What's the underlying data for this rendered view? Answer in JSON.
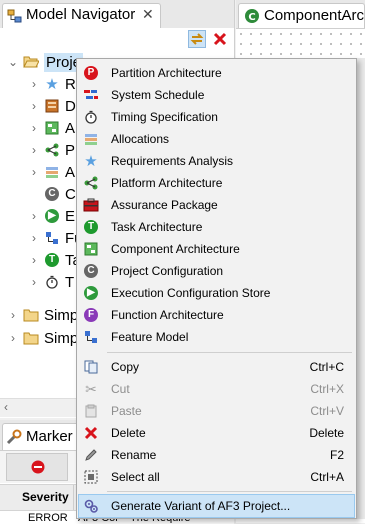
{
  "colors": {
    "selection": "#cce4f7",
    "selection_border": "#99c9ef"
  },
  "navigator": {
    "title": "Model Navigator",
    "tree": [
      {
        "label": "Proje",
        "icon": "open-folder-icon",
        "expanded": true
      },
      {
        "label": "R",
        "icon": "star-icon"
      },
      {
        "label": "D",
        "icon": "data-dictionary-icon"
      },
      {
        "label": "A",
        "icon": "component-icon"
      },
      {
        "label": "P",
        "icon": "platform-icon"
      },
      {
        "label": "A",
        "icon": "allocation-icon"
      },
      {
        "label": "C",
        "icon": "configuration-icon"
      },
      {
        "label": "E",
        "icon": "execution-icon"
      },
      {
        "label": "Fu",
        "icon": "feature-icon"
      },
      {
        "label": "Ta",
        "icon": "task-icon"
      },
      {
        "label": "T",
        "icon": "stopwatch-icon"
      },
      {
        "label": "Simp",
        "icon": "folder-icon"
      },
      {
        "label": "Simp",
        "icon": "folder-icon"
      }
    ]
  },
  "markers": {
    "title": "Marker T",
    "column_severity": "Severity",
    "row_severity": "ERROR",
    "row_element": "AF3 Cor",
    "row_message": "The Require"
  },
  "editor": {
    "title": "ComponentArch"
  },
  "context_menu": {
    "group1": [
      {
        "label": "Partition Architecture",
        "icon": "partition-icon"
      },
      {
        "label": "System Schedule",
        "icon": "schedule-icon"
      },
      {
        "label": "Timing Specification",
        "icon": "stopwatch-icon"
      },
      {
        "label": "Allocations",
        "icon": "allocation-icon"
      },
      {
        "label": "Requirements Analysis",
        "icon": "star-icon"
      },
      {
        "label": "Platform Architecture",
        "icon": "platform-icon"
      },
      {
        "label": "Assurance Package",
        "icon": "assurance-icon"
      },
      {
        "label": "Task Architecture",
        "icon": "task-icon"
      },
      {
        "label": "Component Architecture",
        "icon": "component-icon"
      },
      {
        "label": "Project Configuration",
        "icon": "configuration-icon"
      },
      {
        "label": "Execution Configuration Store",
        "icon": "execution-icon"
      },
      {
        "label": "Function Architecture",
        "icon": "function-icon"
      },
      {
        "label": "Feature Model",
        "icon": "feature-icon"
      }
    ],
    "group2": [
      {
        "label": "Copy",
        "shortcut": "Ctrl+C",
        "icon": "copy-icon",
        "enabled": true
      },
      {
        "label": "Cut",
        "shortcut": "Ctrl+X",
        "icon": "cut-icon",
        "enabled": false
      },
      {
        "label": "Paste",
        "shortcut": "Ctrl+V",
        "icon": "paste-icon",
        "enabled": false
      },
      {
        "label": "Delete",
        "shortcut": "Delete",
        "icon": "delete-icon",
        "enabled": true
      },
      {
        "label": "Rename",
        "shortcut": "F2",
        "icon": "rename-icon",
        "enabled": true
      },
      {
        "label": "Select all",
        "shortcut": "Ctrl+A",
        "icon": "select-all-icon",
        "enabled": true
      }
    ],
    "group3": [
      {
        "label": "Generate Variant of AF3 Project...",
        "icon": "generate-variant-icon",
        "highlighted": true
      }
    ]
  }
}
